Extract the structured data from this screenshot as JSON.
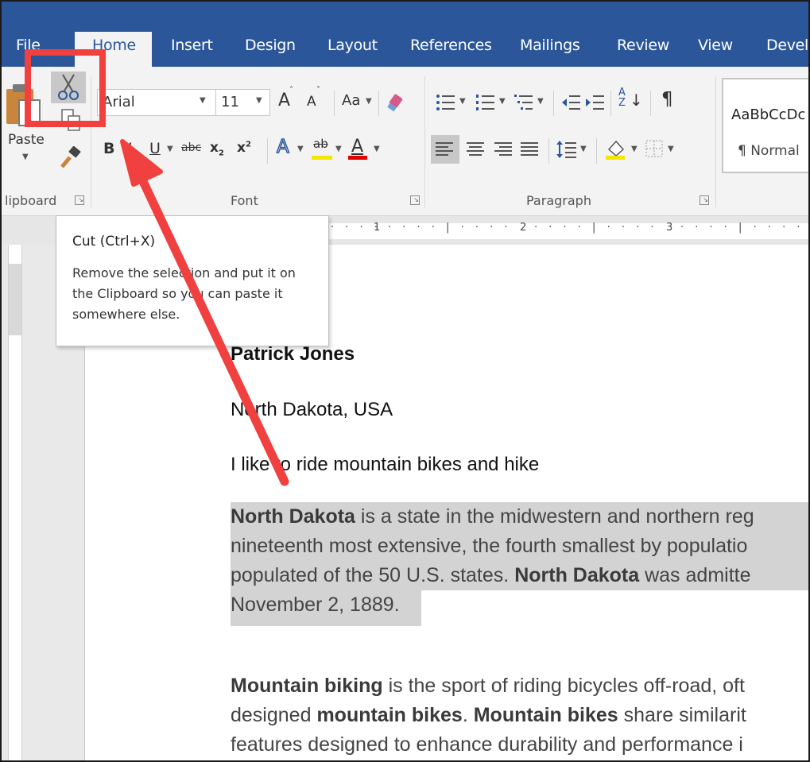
{
  "tabs": [
    "File",
    "Home",
    "Insert",
    "Design",
    "Layout",
    "References",
    "Mailings",
    "Review",
    "View",
    "Develo"
  ],
  "active_tab": "Home",
  "clipboard": {
    "paste_label": "Paste",
    "group_label": "lipboard"
  },
  "font": {
    "name": "Arial",
    "size": "11",
    "change_case_label": "Aa",
    "group_label": "Font",
    "bold": "B",
    "italic": "I",
    "underline": "U",
    "strikethrough": "abc",
    "subscript": "x",
    "superscript": "x",
    "grow": "A",
    "shrink": "A",
    "text_effects": "A",
    "highlight": "ab",
    "font_color": "A"
  },
  "paragraph": {
    "group_label": "Paragraph",
    "sort": "A",
    "show_marks": "¶"
  },
  "styles": {
    "preview": "AaBbCcDc",
    "name": "¶ Normal"
  },
  "ruler": {
    "marks": [
      "1",
      "2",
      "3"
    ]
  },
  "tooltip": {
    "title": "Cut (Ctrl+X)",
    "lines": [
      "Remove the selection and put it on",
      "the Clipboard so you can paste it",
      "somewhere else."
    ]
  },
  "document": {
    "name": "Patrick Jones",
    "location": "North Dakota, USA",
    "hobby": "I like to ride mountain bikes and hike",
    "para1": {
      "line1_bold": "North Dakota",
      "line1_rest": " is a state in the midwestern and northern reg",
      "line2": "nineteenth most extensive, the fourth smallest by populatio",
      "line3_pre": "populated of the 50 U.S. states. ",
      "line3_bold": "North Dakota",
      "line3_post": " was admitte",
      "line4": "November 2, 1889."
    },
    "para2": {
      "line1_bold": "Mountain biking",
      "line1_rest": " is the sport of riding bicycles off-road, oft",
      "line2_pre": "designed ",
      "line2_bold1": "mountain bikes",
      "line2_mid": ". ",
      "line2_bold2": "Mountain bikes",
      "line2_post": " share similarit",
      "line3": "features designed to enhance durability and performance i"
    }
  },
  "colors": {
    "ribbon_blue": "#2b579a",
    "annotation_red": "#f04040",
    "selection_gray": "#d3d3d3"
  },
  "icons": [
    "cut-icon",
    "copy-icon",
    "paste-icon",
    "format-painter-icon",
    "clear-formatting-icon",
    "bullets-icon",
    "numbering-icon",
    "multilevel-list-icon",
    "decrease-indent-icon",
    "increase-indent-icon",
    "sort-icon",
    "show-marks-icon",
    "align-left-icon",
    "center-icon",
    "align-right-icon",
    "justify-icon",
    "line-spacing-icon",
    "shading-icon",
    "borders-icon"
  ]
}
